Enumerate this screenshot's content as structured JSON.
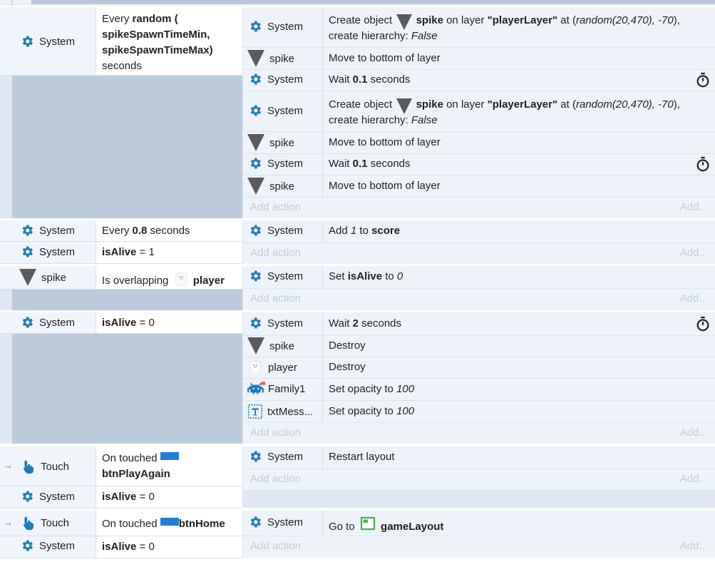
{
  "events": {
    "e1": {
      "cond_object": "System",
      "cond": {
        "every": "Every",
        "random": "random (",
        "min": "spikeSpawnTimeMin,",
        "max": "spikeSpawnTimeMax)",
        "unit": "seconds"
      },
      "actions": [
        {
          "object": "System",
          "p1": "Create object",
          "obj": "spike",
          "p2": "on layer",
          "layer": "\"playerLayer\"",
          "p3": "at (",
          "args": "random(20,470), -70",
          "p4": "),",
          "line2a": "create hierarchy:",
          "line2b": "False"
        },
        {
          "object": "spike",
          "text": "Move to bottom of layer"
        },
        {
          "object": "System",
          "p1": "Wait",
          "val": "0.1",
          "p2": "seconds"
        },
        {
          "object": "System",
          "p1": "Create object",
          "obj": "spike",
          "p2": "on layer",
          "layer": "\"playerLayer\"",
          "p3": "at (",
          "args": "random(20,470), -70",
          "p4": "),",
          "line2a": "create hierarchy:",
          "line2b": "False"
        },
        {
          "object": "spike",
          "text": "Move to bottom of layer"
        },
        {
          "object": "System",
          "p1": "Wait",
          "val": "0.1",
          "p2": "seconds"
        },
        {
          "object": "spike",
          "text": "Move to bottom of layer"
        }
      ]
    },
    "e2": {
      "conds": [
        {
          "object": "System",
          "p1": "Every",
          "val": "0.8",
          "p2": "seconds"
        },
        {
          "object": "System",
          "var": "isAlive",
          "p1": "= 1"
        }
      ],
      "action": {
        "object": "System",
        "p1": "Add",
        "val": "1",
        "p2": "to",
        "var": "score"
      }
    },
    "e3": {
      "cond": {
        "object": "spike",
        "p1": "Is overlapping",
        "target": "player"
      },
      "action": {
        "object": "System",
        "p1": "Set",
        "var": "isAlive",
        "p2": "to",
        "val": "0"
      }
    },
    "e4": {
      "cond": {
        "object": "System",
        "var": "isAlive",
        "p1": "= 0"
      },
      "actions": [
        {
          "object": "System",
          "p1": "Wait",
          "val": "2",
          "p2": "seconds"
        },
        {
          "object": "spike",
          "text": "Destroy"
        },
        {
          "object": "player",
          "text": "Destroy"
        },
        {
          "object": "Family1",
          "p1": "Set opacity to",
          "val": "100"
        },
        {
          "object": "txtMess...",
          "p1": "Set opacity to",
          "val": "100"
        }
      ]
    },
    "e5": {
      "conds": [
        {
          "object": "Touch",
          "p1": "On touched",
          "target": "btnPlayAgain"
        },
        {
          "object": "System",
          "var": "isAlive",
          "p1": "= 0"
        }
      ],
      "action": {
        "object": "System",
        "text": "Restart layout"
      }
    },
    "e6": {
      "conds": [
        {
          "object": "Touch",
          "p1": "On touched",
          "target": "btnHome"
        },
        {
          "object": "System",
          "var": "isAlive",
          "p1": "= 0"
        }
      ],
      "action": {
        "object": "System",
        "p1": "Go to",
        "target": "gameLayout"
      }
    }
  },
  "ui": {
    "add_action": "Add action",
    "add_more": "Add..."
  },
  "colors": {
    "row_bg": "#eef3f9",
    "gutter": "#bccbdc",
    "icon_blue": "#1f7fd3",
    "trigger_green": "#3aa53a"
  }
}
